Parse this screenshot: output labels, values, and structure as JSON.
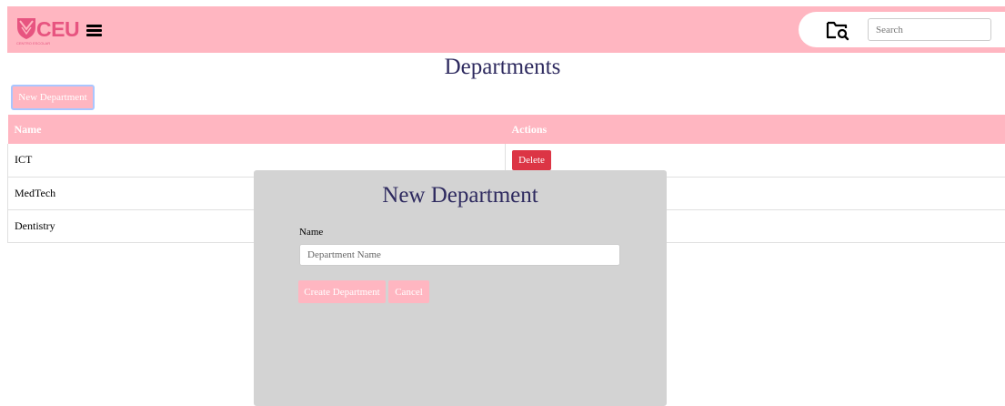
{
  "header": {
    "logo_text": "CEU",
    "logo_subtext": "CENTRO ESCOLAR",
    "search_placeholder": "Search",
    "brand_color": "#ffb6c1",
    "logo_color": "#e75480"
  },
  "page": {
    "title": "Departments",
    "new_button_label": "New Department"
  },
  "table": {
    "columns": [
      "Name",
      "Actions"
    ],
    "rows": [
      {
        "name": "ICT",
        "action": "Delete"
      },
      {
        "name": "MedTech",
        "action": ""
      },
      {
        "name": "Dentistry",
        "action": ""
      }
    ]
  },
  "modal": {
    "title": "New Department",
    "field_label": "Name",
    "field_placeholder": "Department Name",
    "create_label": "Create Department",
    "cancel_label": "Cancel"
  }
}
